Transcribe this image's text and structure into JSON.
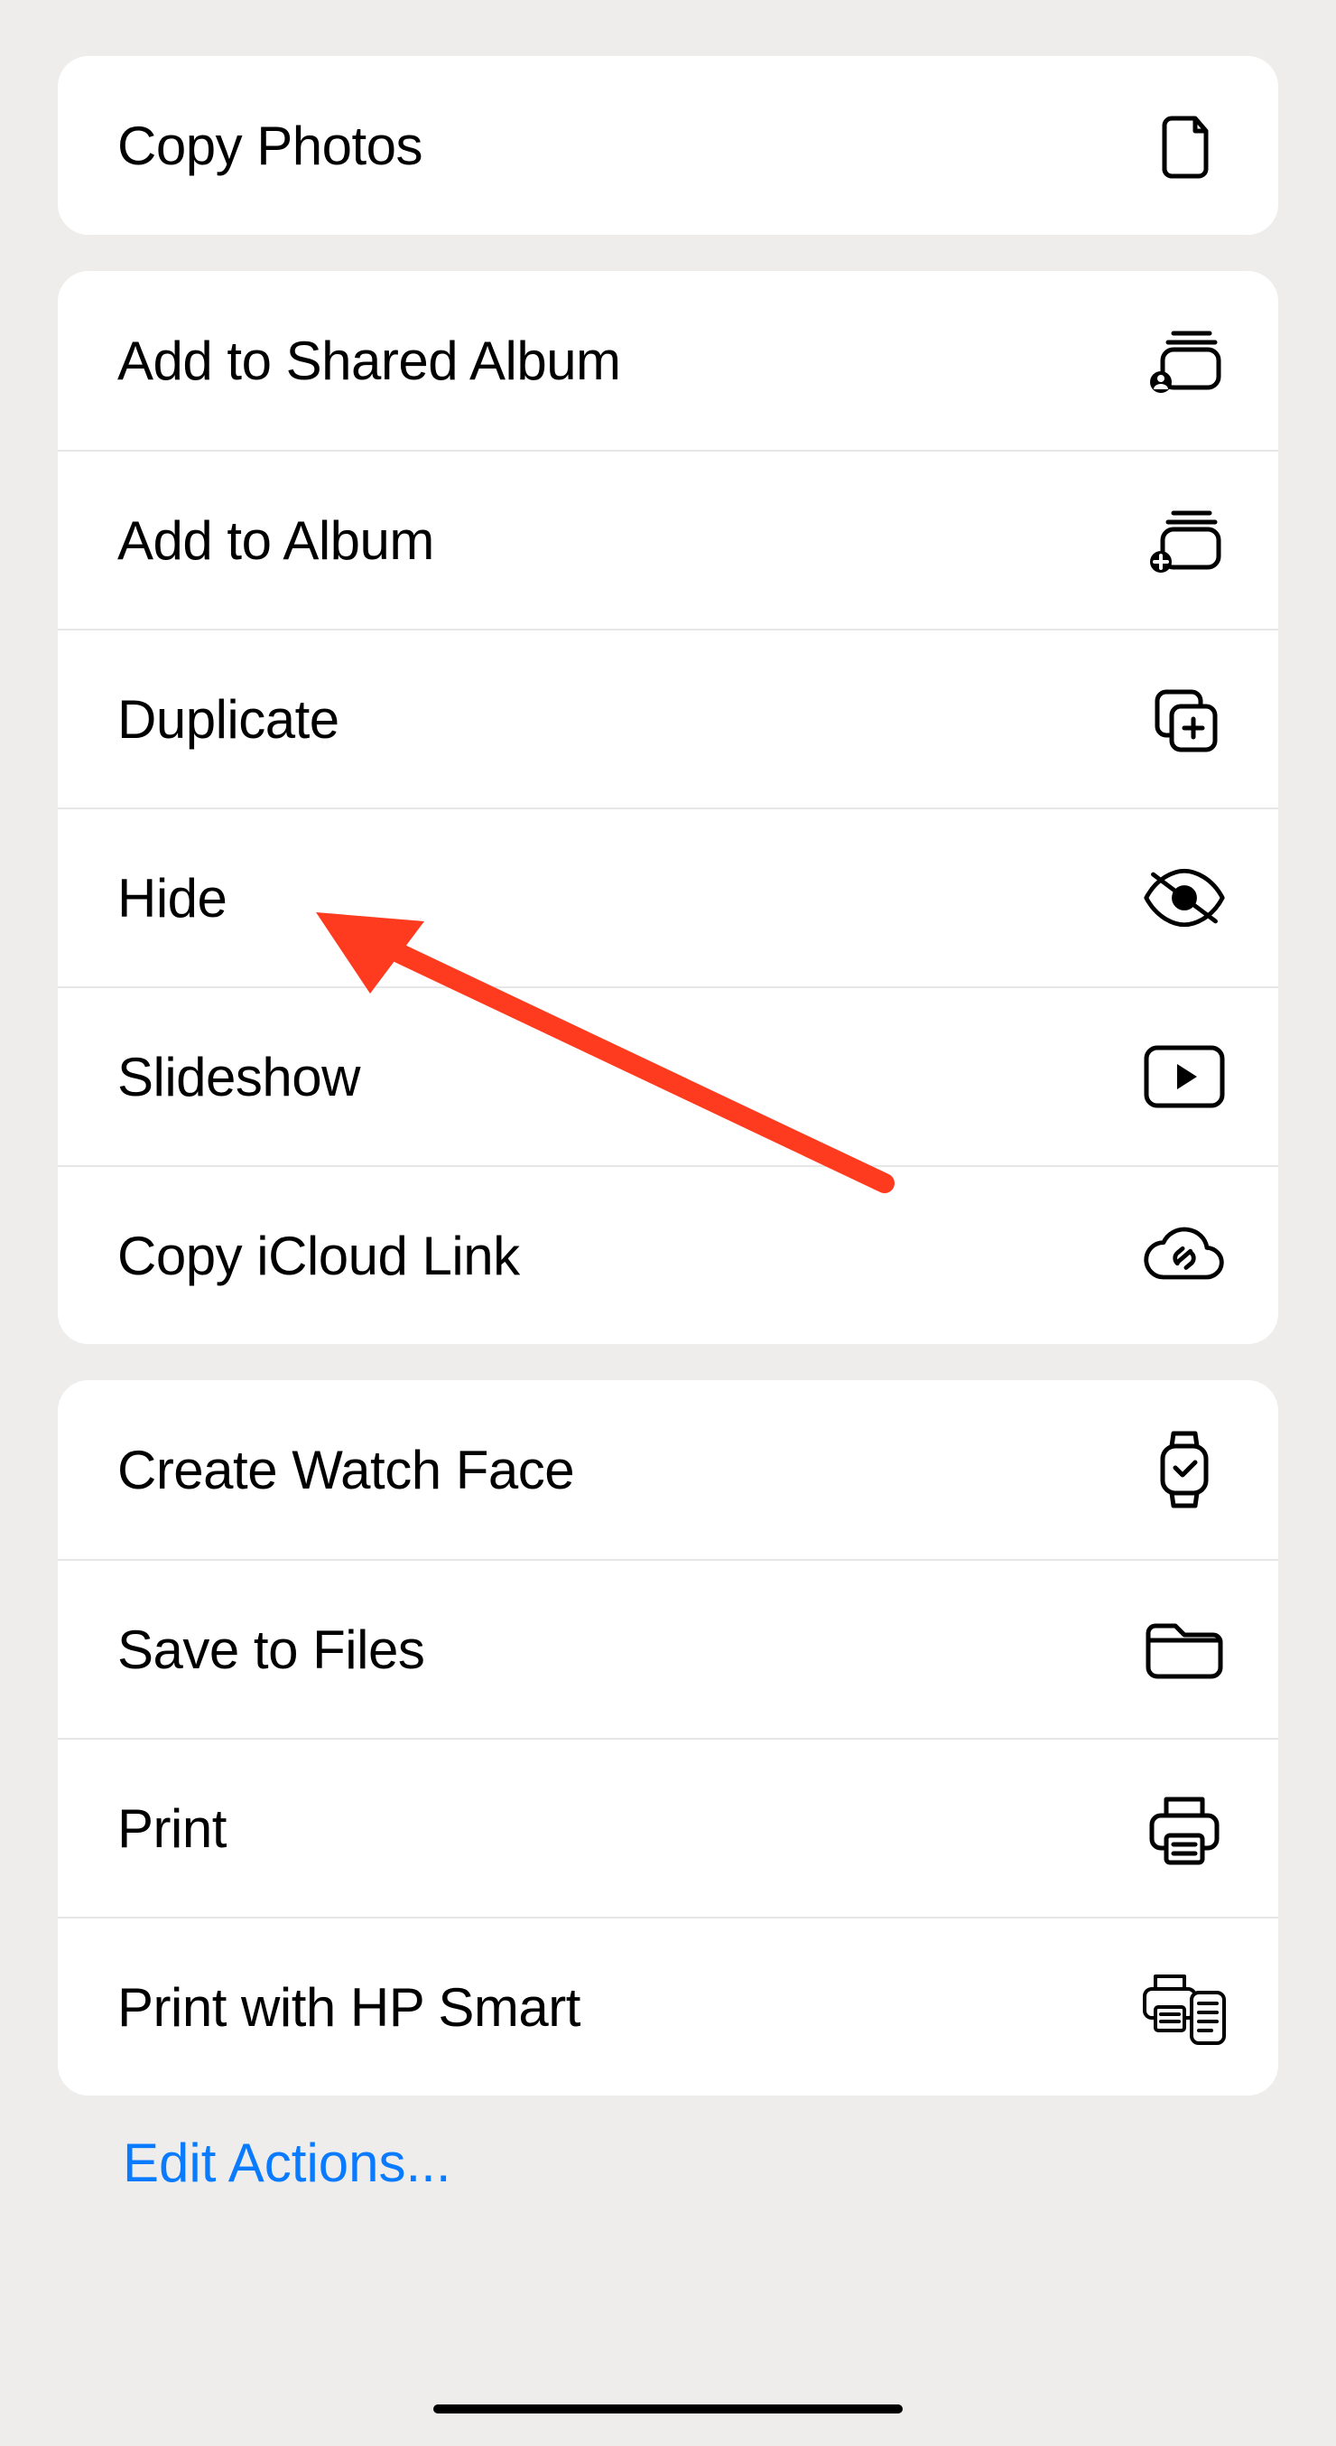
{
  "groups": [
    {
      "items": [
        {
          "id": "copy-photos",
          "label": "Copy Photos",
          "icon": "copy-icon"
        }
      ]
    },
    {
      "items": [
        {
          "id": "add-shared-album",
          "label": "Add to Shared Album",
          "icon": "shared-album-icon"
        },
        {
          "id": "add-album",
          "label": "Add to Album",
          "icon": "album-add-icon"
        },
        {
          "id": "duplicate",
          "label": "Duplicate",
          "icon": "duplicate-icon"
        },
        {
          "id": "hide",
          "label": "Hide",
          "icon": "eye-slash-icon"
        },
        {
          "id": "slideshow",
          "label": "Slideshow",
          "icon": "play-rect-icon"
        },
        {
          "id": "copy-icloud",
          "label": "Copy iCloud Link",
          "icon": "cloud-link-icon"
        }
      ]
    },
    {
      "items": [
        {
          "id": "watch-face",
          "label": "Create Watch Face",
          "icon": "watch-icon"
        },
        {
          "id": "save-files",
          "label": "Save to Files",
          "icon": "folder-icon"
        },
        {
          "id": "print",
          "label": "Print",
          "icon": "printer-icon"
        },
        {
          "id": "print-hp",
          "label": "Print with HP Smart",
          "icon": "hp-print-icon"
        }
      ]
    }
  ],
  "edit_actions_label": "Edit Actions...",
  "annotation": {
    "arrow_color": "#ff3b1f"
  }
}
